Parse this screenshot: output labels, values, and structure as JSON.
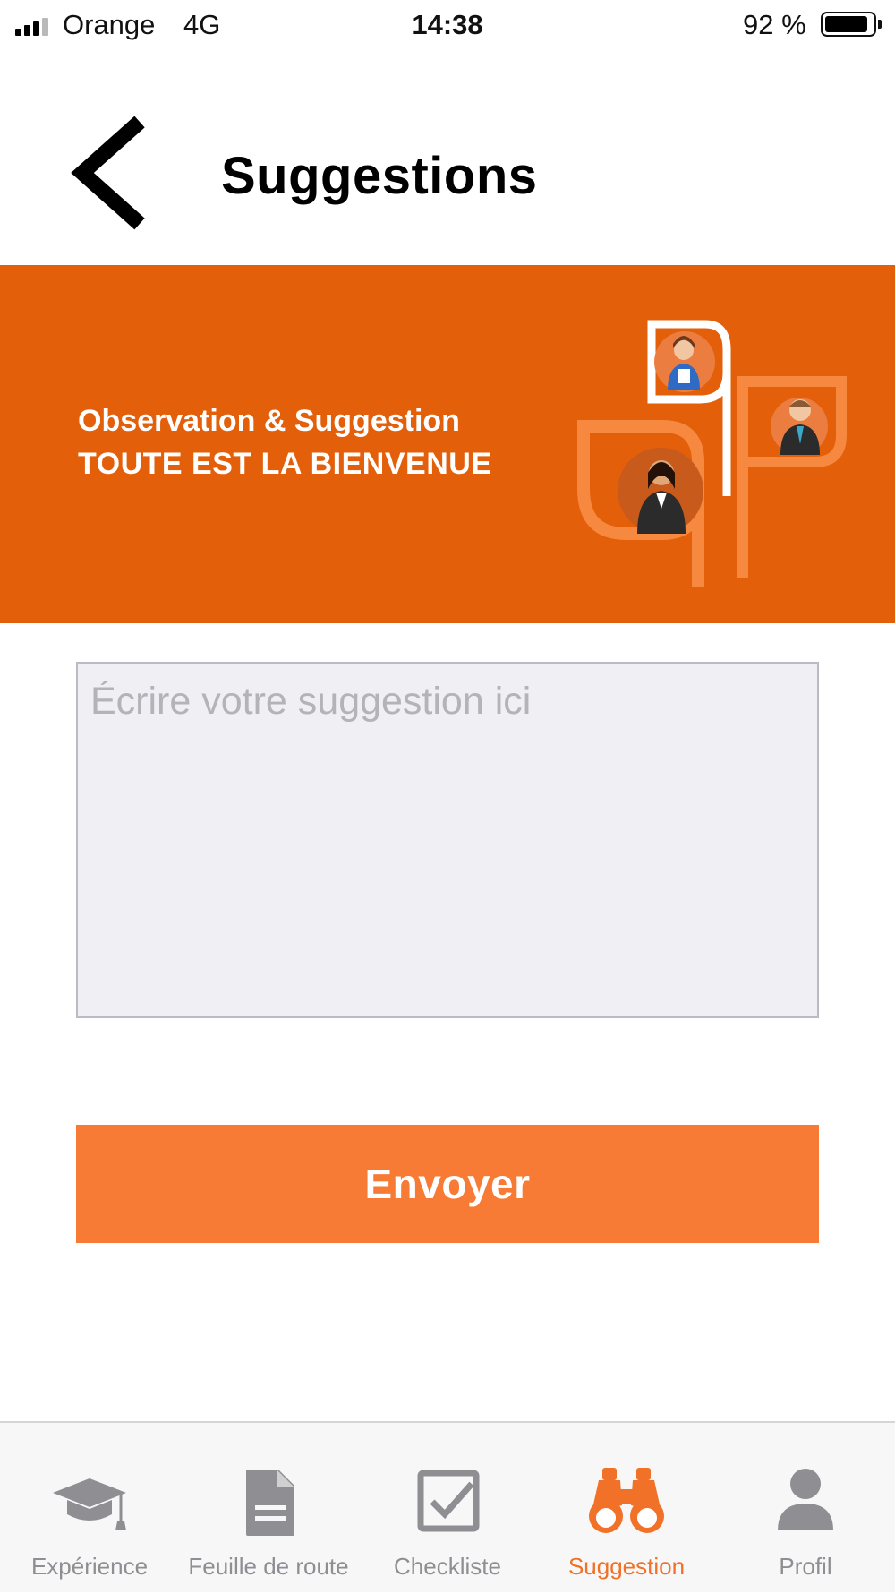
{
  "status_bar": {
    "carrier": "Orange",
    "network": "4G",
    "time": "14:38",
    "battery": "92 %",
    "battery_level": 0.92
  },
  "header": {
    "back_icon": "chevron-left-icon",
    "title": "Suggestions"
  },
  "banner": {
    "line1": "Observation & Suggestion",
    "line2": "TOUTE EST LA BIENVENUE",
    "background_color": "#e35f0a",
    "illustration": "people-leaves-illustration"
  },
  "form": {
    "placeholder": "Écrire votre suggestion ici",
    "value": "",
    "send_label": "Envoyer",
    "button_color": "#f77a35"
  },
  "tab_bar": {
    "active_color": "#f07127",
    "inactive_color": "#8e8e93",
    "tabs": [
      {
        "label": "Expérience",
        "icon": "graduation-cap-icon",
        "active": false
      },
      {
        "label": "Feuille de route",
        "icon": "document-icon",
        "active": false
      },
      {
        "label": "Checkliste",
        "icon": "checkbox-icon",
        "active": false
      },
      {
        "label": "Suggestion",
        "icon": "binoculars-icon",
        "active": true
      },
      {
        "label": "Profil",
        "icon": "user-icon",
        "active": false
      }
    ]
  }
}
